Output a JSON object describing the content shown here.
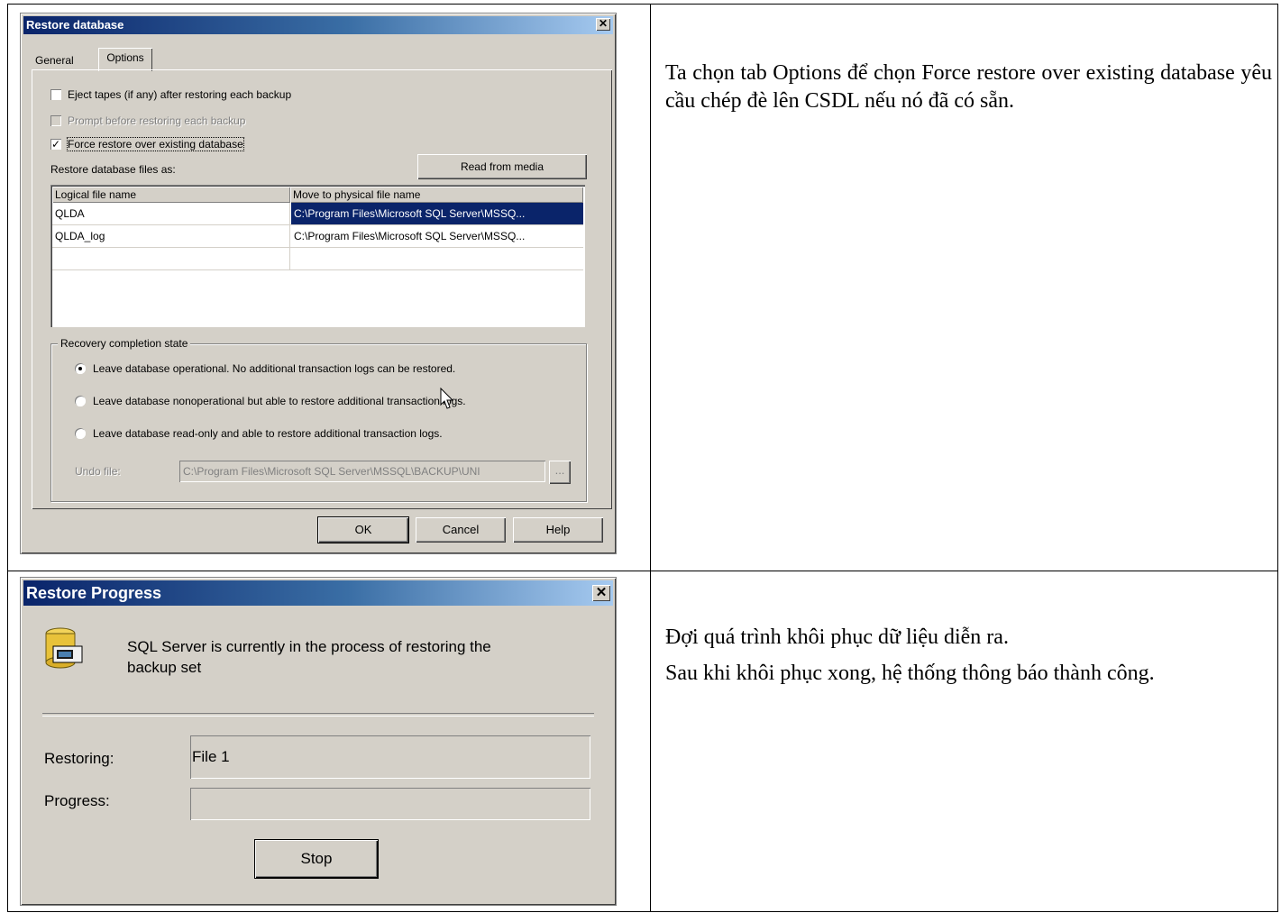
{
  "restore_dialog": {
    "title": "Restore database",
    "tabs": [
      "General",
      "Options"
    ],
    "options": {
      "eject_tapes": "Eject tapes (if any) after restoring each backup",
      "prompt_before": "Prompt before restoring each backup",
      "force_restore": "Force restore over existing database"
    },
    "restore_files_label": "Restore database files as:",
    "read_from_media": "Read from media",
    "grid": {
      "headers": [
        "Logical file name",
        "Move to physical file name"
      ],
      "rows": [
        {
          "logical": "QLDA",
          "physical": "C:\\Program Files\\Microsoft SQL Server\\MSSQ..."
        },
        {
          "logical": "QLDA_log",
          "physical": "C:\\Program Files\\Microsoft SQL Server\\MSSQ..."
        }
      ]
    },
    "recovery": {
      "legend": "Recovery completion state",
      "opt1": "Leave database operational. No additional transaction logs can be restored.",
      "opt2": "Leave database nonoperational but able to restore additional transaction logs.",
      "opt3": "Leave database read-only and able to restore additional transaction logs.",
      "undo_label": "Undo file:",
      "undo_value": "C:\\Program Files\\Microsoft SQL Server\\MSSQL\\BACKUP\\UNI",
      "browse": "..."
    },
    "buttons": {
      "ok": "OK",
      "cancel": "Cancel",
      "help": "Help"
    }
  },
  "progress_dialog": {
    "title": "Restore Progress",
    "message_line1": "SQL Server is currently in the process of restoring the",
    "message_line2": "backup set",
    "restoring_label": "Restoring:",
    "restoring_value": "File 1",
    "progress_label": "Progress:",
    "stop": "Stop"
  },
  "text": {
    "row1": "Ta chọn tab Options để chọn Force restore over existing database yêu cầu chép đè lên CSDL nếu nó đã có sẵn.",
    "row2_p1": "Đợi quá trình khôi phục dữ liệu diễn ra.",
    "row2_p2": "Sau khi khôi phục xong, hệ thống thông báo thành công."
  }
}
